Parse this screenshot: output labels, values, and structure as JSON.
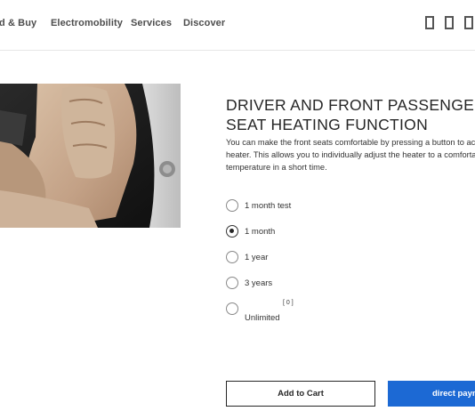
{
  "nav": {
    "items": [
      "d & Buy",
      "Electromobility",
      "Services",
      "Discover"
    ]
  },
  "header_icons": [
    "rectangle-icon",
    "rectangle-icon",
    "rectangle-icon"
  ],
  "product": {
    "image": "car-seat-photo",
    "title": "DRIVER AND FRONT PASSENGE\nSEAT HEATING FUNCTION",
    "description": "You can make the front seats comfortable by pressing a button to ac\nheater. This allows you to individually adjust the heater to a comforta\ntemperature in a short time."
  },
  "options": [
    {
      "label": "1 month test",
      "selected": false
    },
    {
      "label": "1 month",
      "selected": true
    },
    {
      "label": "1 year",
      "selected": false
    },
    {
      "label": "3 years",
      "selected": false
    },
    {
      "label": "Unlimited",
      "selected": false,
      "footnote": "[ 0 ]"
    }
  ],
  "actions": {
    "add_to_cart": "Add to Cart",
    "direct_payment": "direct paym"
  },
  "colors": {
    "accent": "#1c69d4",
    "text": "#262626",
    "seat_leather": "#c7a98f",
    "seat_dark": "#1b1b1b"
  }
}
